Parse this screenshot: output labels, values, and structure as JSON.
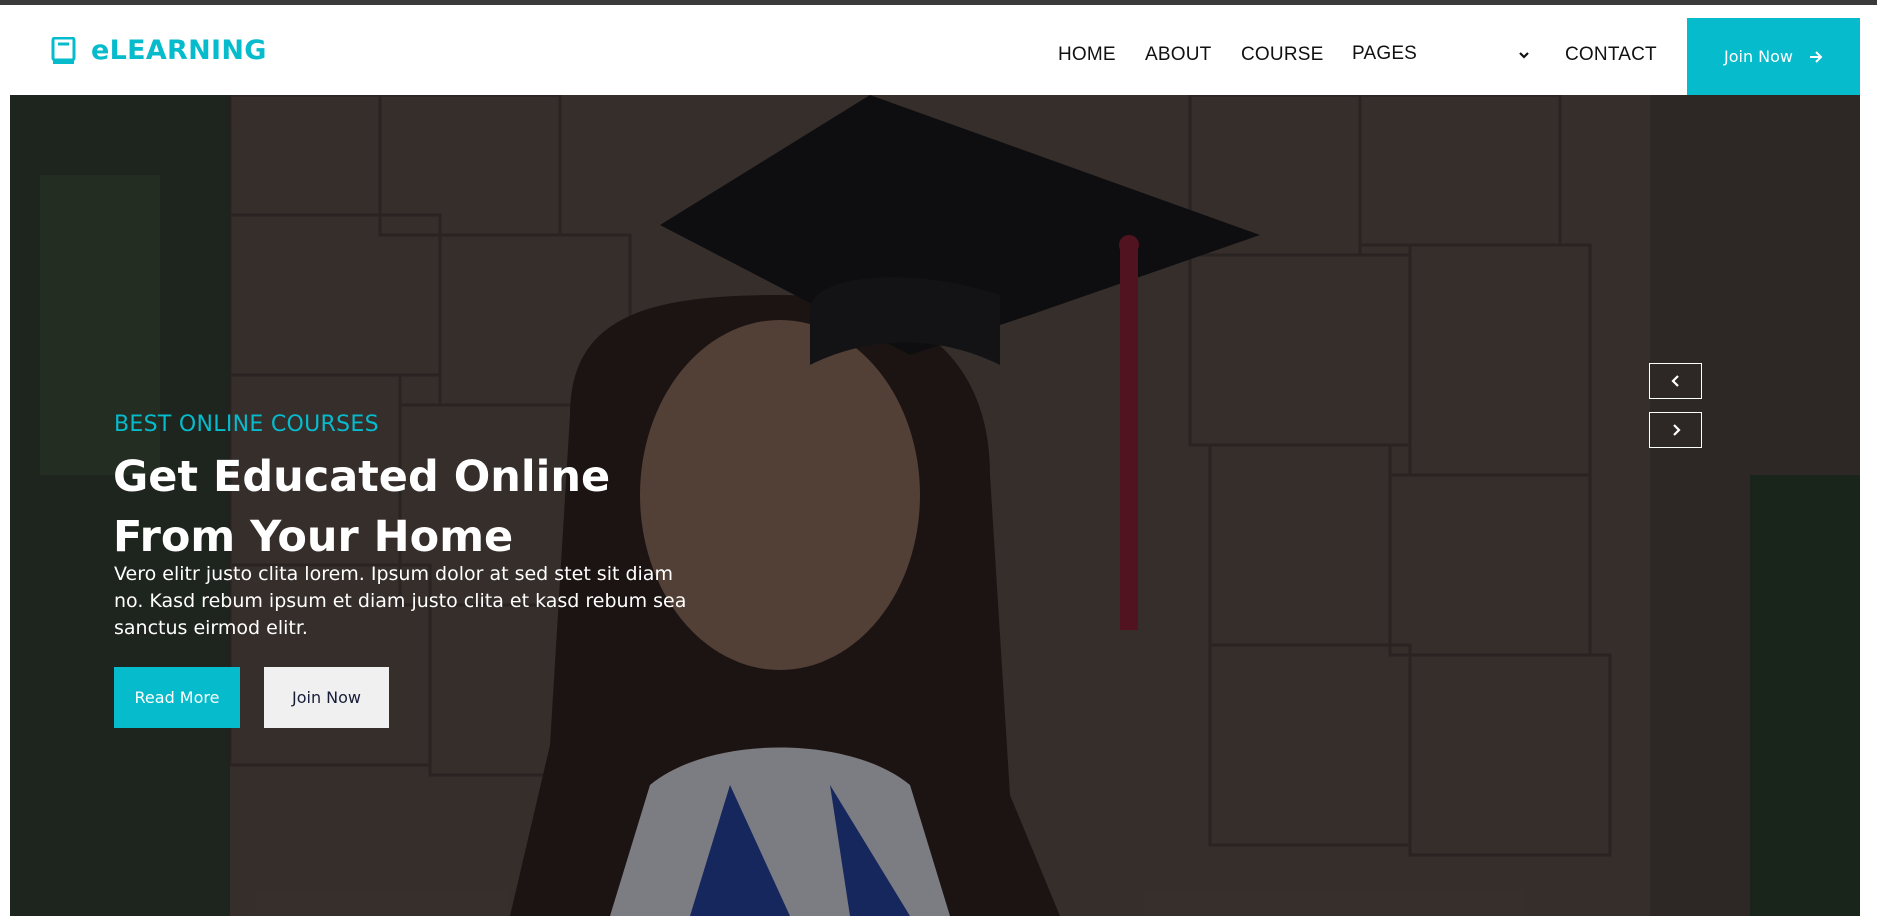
{
  "brand": {
    "name": "eLEARNING",
    "icon": "book-icon",
    "accent_color": "#06bbcc"
  },
  "nav": {
    "items": [
      {
        "label": "HOME"
      },
      {
        "label": "ABOUT"
      },
      {
        "label": "COURSE"
      },
      {
        "label": "PAGES",
        "icon": "chevron-down-icon"
      },
      {
        "label": "CONTACT"
      }
    ],
    "cta": {
      "label": "Join Now",
      "icon": "arrow-right-icon"
    }
  },
  "hero": {
    "subtitle": "BEST ONLINE COURSES",
    "headline_line1": "Get Educated Online",
    "headline_line2": "From Your Home",
    "description": "Vero elitr justo clita lorem. Ipsum dolor at sed stet sit diam no. Kasd rebum ipsum et diam justo clita et kasd rebum sea sanctus eirmod elitr.",
    "primary_button": "Read More",
    "secondary_button": "Join Now",
    "carousel": {
      "prev_icon": "chevron-left-icon",
      "next_icon": "chevron-right-icon"
    }
  }
}
